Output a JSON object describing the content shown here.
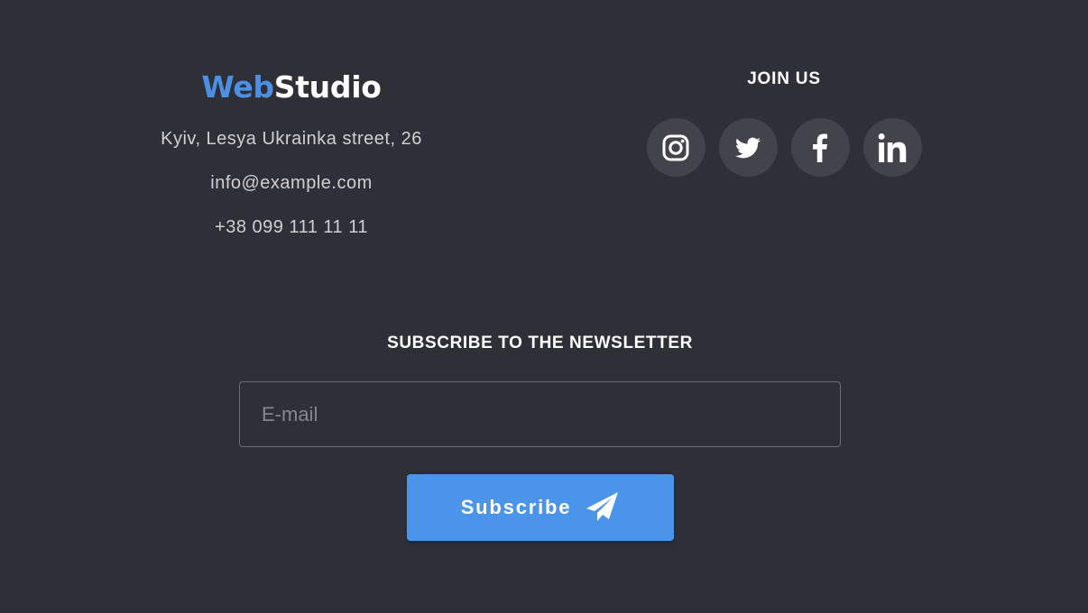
{
  "logo": {
    "part1": "Web",
    "part2": "Studio"
  },
  "contacts": {
    "address": "Kyiv, Lesya Ukrainka street, 26",
    "email": "info@example.com",
    "phone": "+38 099 111 11 11"
  },
  "join": {
    "title": "JOIN US",
    "social": [
      {
        "name": "instagram",
        "icon": "instagram-icon"
      },
      {
        "name": "twitter",
        "icon": "twitter-icon"
      },
      {
        "name": "facebook",
        "icon": "facebook-icon"
      },
      {
        "name": "linkedin",
        "icon": "linkedin-icon"
      }
    ]
  },
  "newsletter": {
    "title": "SUBSCRIBE TO THE NEWSLETTER",
    "email_placeholder": "E-mail",
    "email_value": "",
    "button_label": "Subscribe",
    "button_icon": "paper-plane-icon"
  },
  "colors": {
    "background": "#2f2f38",
    "accent": "#4a94ea",
    "logo_accent": "#4d8fe3",
    "social_circle": "#43434c"
  }
}
